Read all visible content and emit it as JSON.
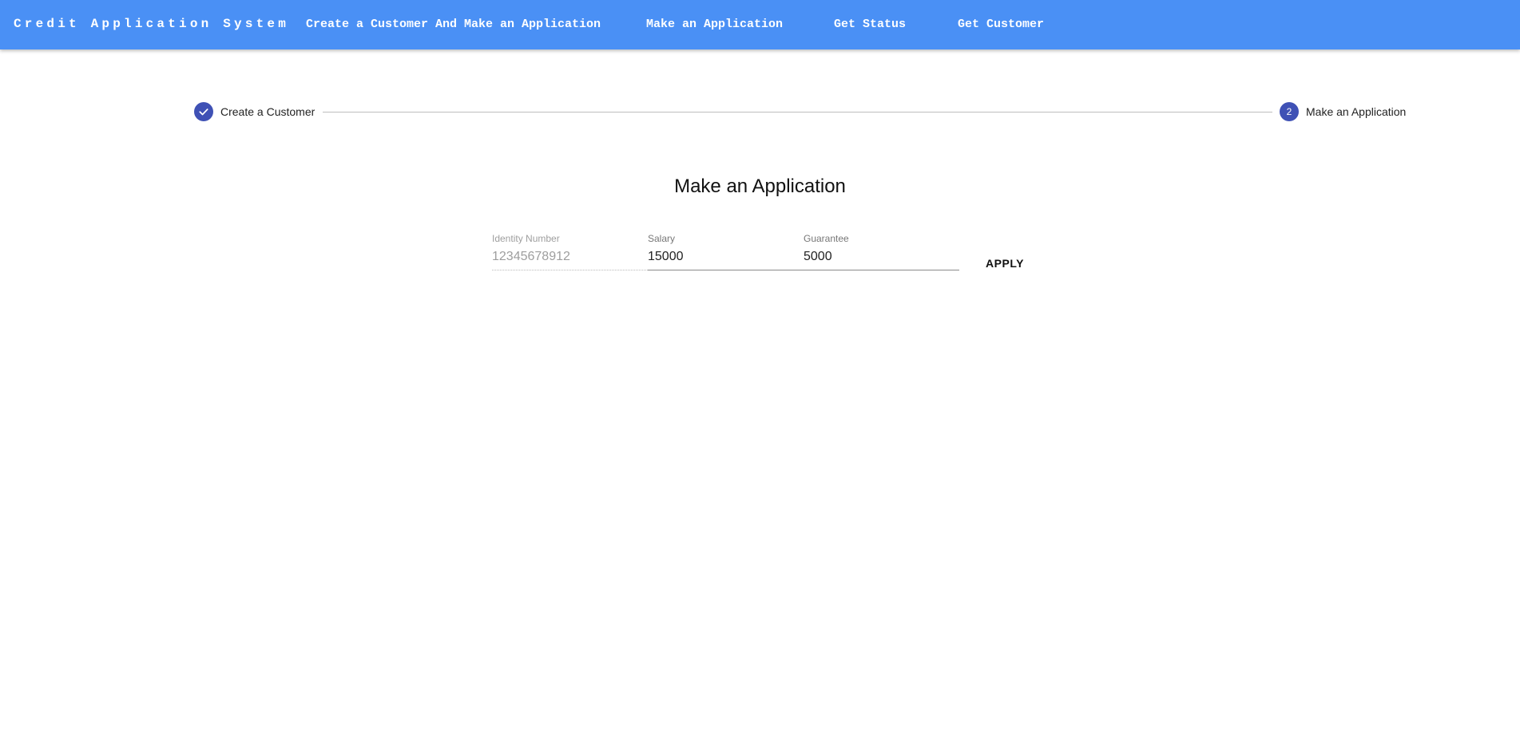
{
  "navbar": {
    "brand": "Credit Application System",
    "links": [
      "Create a Customer And Make an Application",
      "Make an Application",
      "Get Status",
      "Get Customer"
    ]
  },
  "stepper": {
    "steps": [
      {
        "label": "Create a Customer",
        "state": "completed",
        "icon": "check-icon"
      },
      {
        "label": "Make an Application",
        "state": "active",
        "number": "2"
      }
    ],
    "accent_color": "#3f51b5"
  },
  "form": {
    "title": "Make an Application",
    "identity_number": {
      "label": "Identity Number",
      "value": "12345678912",
      "disabled": true
    },
    "salary": {
      "label": "Salary",
      "value": "15000"
    },
    "guarantee": {
      "label": "Guarantee",
      "value": "5000"
    },
    "apply_label": "APPLY"
  },
  "colors": {
    "navbar_bg": "#4a90f5",
    "text_on_nav": "#ffffff"
  }
}
